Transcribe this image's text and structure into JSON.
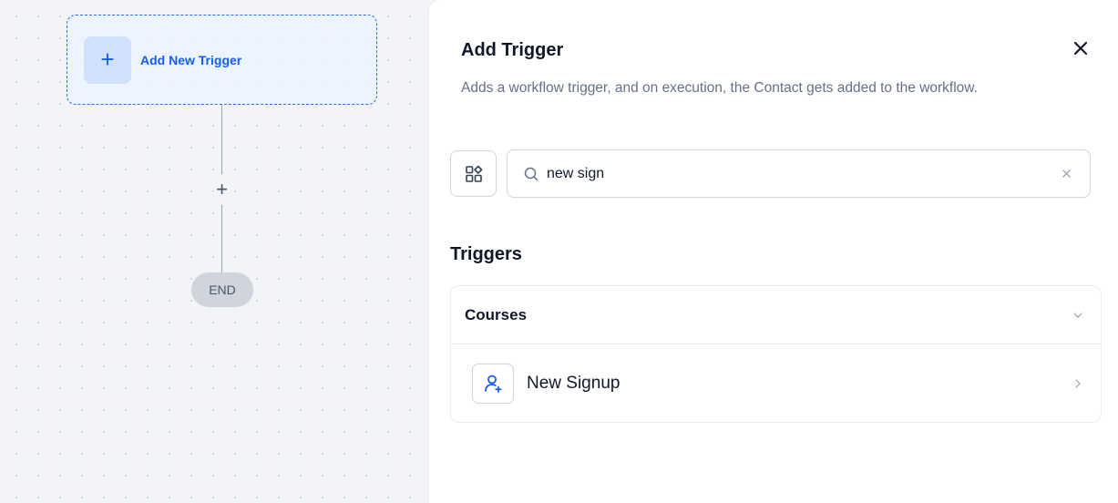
{
  "canvas": {
    "trigger_label": "Add New Trigger",
    "add_step_symbol": "+",
    "end_label": "END",
    "plus_symbol": "+"
  },
  "panel": {
    "title": "Add Trigger",
    "description": "Adds a workflow trigger, and on execution, the Contact gets added to the workflow.",
    "search": {
      "value": "new sign",
      "placeholder": ""
    },
    "section_heading": "Triggers",
    "groups": [
      {
        "title": "Courses",
        "items": [
          {
            "label": "New Signup",
            "icon": "user-plus-icon"
          }
        ]
      }
    ]
  },
  "colors": {
    "accent": "#155eef",
    "trigger_bg": "#ebf3ff",
    "end_pill": "#d0d5dd"
  }
}
